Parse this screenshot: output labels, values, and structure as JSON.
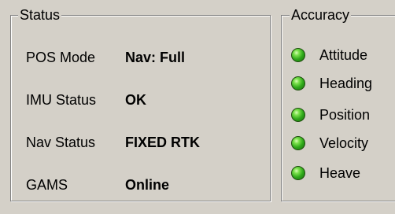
{
  "status": {
    "title": "Status",
    "rows": [
      {
        "label": "POS Mode",
        "value": "Nav: Full"
      },
      {
        "label": "IMU Status",
        "value": "OK"
      },
      {
        "label": "Nav Status",
        "value": "FIXED RTK"
      },
      {
        "label": "GAMS",
        "value": "Online"
      }
    ]
  },
  "accuracy": {
    "title": "Accuracy",
    "items": [
      {
        "label": "Attitude",
        "indicator": "green-led"
      },
      {
        "label": "Heading",
        "indicator": "green-led"
      },
      {
        "label": "Position",
        "indicator": "green-led"
      },
      {
        "label": "Velocity",
        "indicator": "green-led"
      },
      {
        "label": "Heave",
        "indicator": "green-led"
      }
    ]
  },
  "colors": {
    "background": "#d4d0c8",
    "led_green": "#2fa81a"
  }
}
